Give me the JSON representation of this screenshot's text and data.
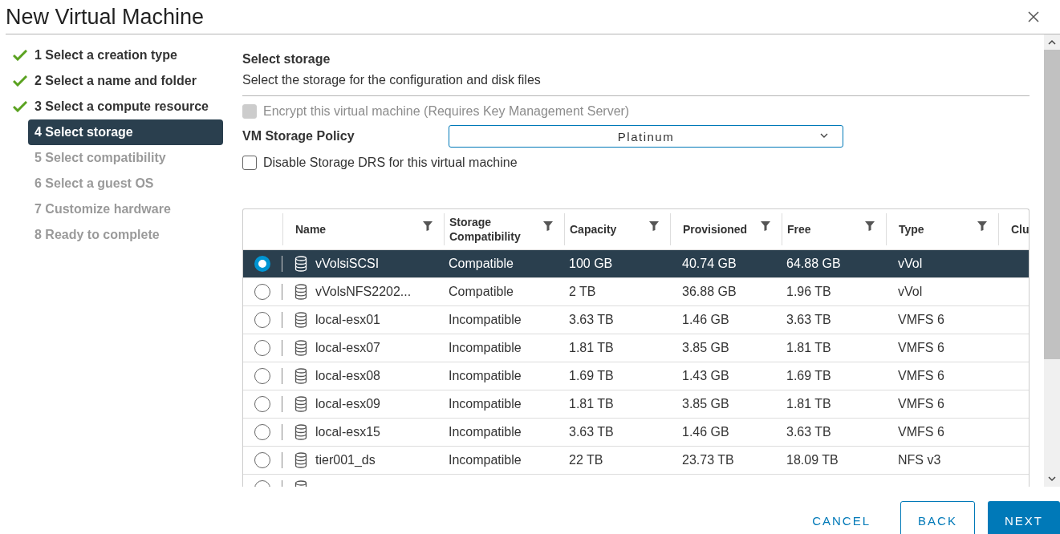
{
  "window": {
    "title": "New Virtual Machine"
  },
  "steps": [
    {
      "label": "1 Select a creation type",
      "done": true,
      "selected": false,
      "disabled": false
    },
    {
      "label": "2 Select a name and folder",
      "done": true,
      "selected": false,
      "disabled": false
    },
    {
      "label": "3 Select a compute resource",
      "done": true,
      "selected": false,
      "disabled": false
    },
    {
      "label": "4 Select storage",
      "done": false,
      "selected": true,
      "disabled": false
    },
    {
      "label": "5 Select compatibility",
      "done": false,
      "selected": false,
      "disabled": true
    },
    {
      "label": "6 Select a guest OS",
      "done": false,
      "selected": false,
      "disabled": true
    },
    {
      "label": "7 Customize hardware",
      "done": false,
      "selected": false,
      "disabled": true
    },
    {
      "label": "8 Ready to complete",
      "done": false,
      "selected": false,
      "disabled": true
    }
  ],
  "page": {
    "heading": "Select storage",
    "description": "Select the storage for the configuration and disk files"
  },
  "encrypt": {
    "label": "Encrypt this virtual machine (Requires Key Management Server)",
    "checked": false,
    "disabled": true
  },
  "policy": {
    "label": "VM Storage Policy",
    "value": "Platinum"
  },
  "disable_drs": {
    "label": "Disable Storage DRS for this virtual machine",
    "checked": false,
    "disabled": false
  },
  "table": {
    "columns": [
      {
        "label": "Name",
        "filter": true
      },
      {
        "label": "Storage Compatibility",
        "filter": true
      },
      {
        "label": "Capacity",
        "filter": true
      },
      {
        "label": "Provisioned",
        "filter": true
      },
      {
        "label": "Free",
        "filter": true
      },
      {
        "label": "Type",
        "filter": true
      },
      {
        "label": "Clu",
        "filter": false
      }
    ],
    "rows": [
      {
        "selected": true,
        "cells": [
          "vVolsiSCSI",
          "Compatible",
          "100 GB",
          "40.74 GB",
          "64.88 GB",
          "vVol"
        ]
      },
      {
        "selected": false,
        "cells": [
          "vVolsNFS2202...",
          "Compatible",
          "2 TB",
          "36.88 GB",
          "1.96 TB",
          "vVol"
        ]
      },
      {
        "selected": false,
        "cells": [
          "local-esx01",
          "Incompatible",
          "3.63 TB",
          "1.46 GB",
          "3.63 TB",
          "VMFS 6"
        ]
      },
      {
        "selected": false,
        "cells": [
          "local-esx07",
          "Incompatible",
          "1.81 TB",
          "3.85 GB",
          "1.81 TB",
          "VMFS 6"
        ]
      },
      {
        "selected": false,
        "cells": [
          "local-esx08",
          "Incompatible",
          "1.69 TB",
          "1.43 GB",
          "1.69 TB",
          "VMFS 6"
        ]
      },
      {
        "selected": false,
        "cells": [
          "local-esx09",
          "Incompatible",
          "1.81 TB",
          "3.85 GB",
          "1.81 TB",
          "VMFS 6"
        ]
      },
      {
        "selected": false,
        "cells": [
          "local-esx15",
          "Incompatible",
          "3.63 TB",
          "1.46 GB",
          "3.63 TB",
          "VMFS 6"
        ]
      },
      {
        "selected": false,
        "cells": [
          "tier001_ds",
          "Incompatible",
          "22 TB",
          "23.73 TB",
          "18.09 TB",
          "NFS v3"
        ]
      },
      {
        "selected": false,
        "cells": []
      }
    ]
  },
  "buttons": [
    {
      "label": "CANCEL",
      "kind": "flat"
    },
    {
      "label": "BACK",
      "kind": "outline"
    },
    {
      "label": "NEXT",
      "kind": "primary"
    }
  ]
}
